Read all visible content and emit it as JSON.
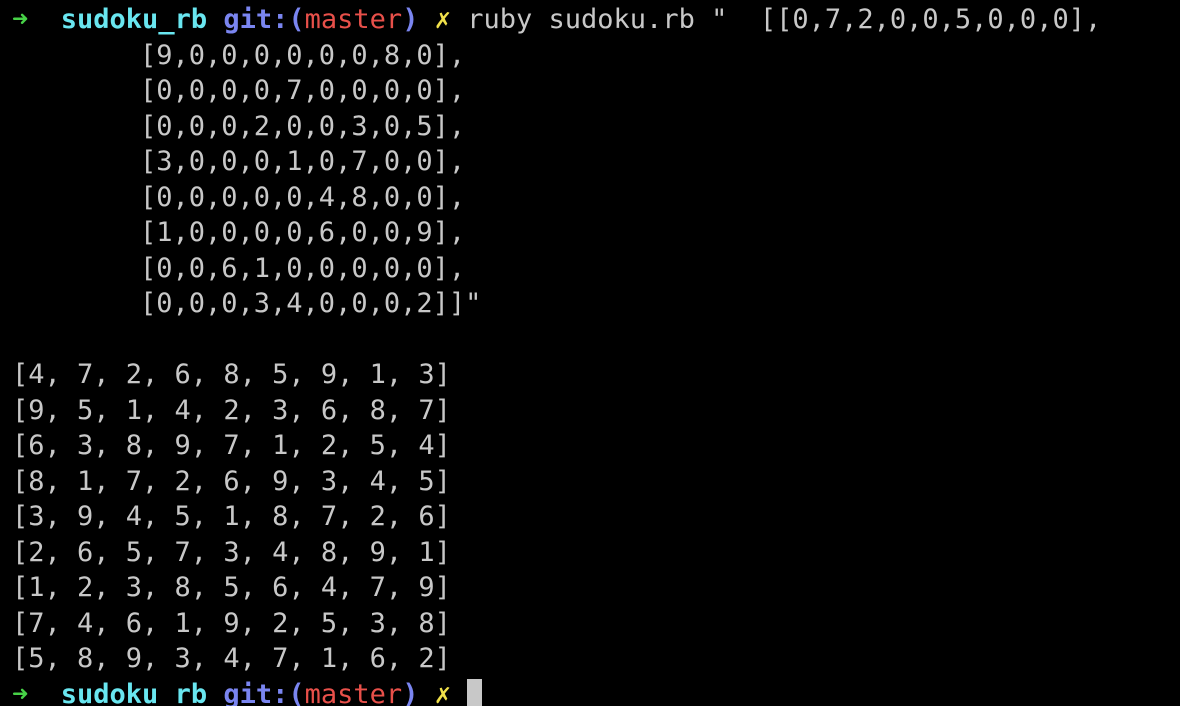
{
  "prompt": {
    "arrow": "➜",
    "directory": "sudoku_rb",
    "git_prefix": "git:(",
    "branch": "master",
    "git_suffix": ")",
    "dirty_mark": "✗"
  },
  "command": {
    "text": "ruby sudoku.rb \"  [[0,7,2,0,0,5,0,0,0],",
    "continuation_lines": [
      "[9,0,0,0,0,0,0,8,0],",
      "[0,0,0,0,7,0,0,0,0],",
      "[0,0,0,2,0,0,3,0,5],",
      "[3,0,0,0,1,0,7,0,0],",
      "[0,0,0,0,0,4,8,0,0],",
      "[1,0,0,0,0,6,0,0,9],",
      "[0,0,6,1,0,0,0,0,0],",
      "[0,0,0,3,4,0,0,0,2]]\""
    ]
  },
  "output": {
    "rows": [
      "[4, 7, 2, 6, 8, 5, 9, 1, 3]",
      "[9, 5, 1, 4, 2, 3, 6, 8, 7]",
      "[6, 3, 8, 9, 7, 1, 2, 5, 4]",
      "[8, 1, 7, 2, 6, 9, 3, 4, 5]",
      "[3, 9, 4, 5, 1, 8, 7, 2, 6]",
      "[2, 6, 5, 7, 3, 4, 8, 9, 1]",
      "[1, 2, 3, 8, 5, 6, 4, 7, 9]",
      "[7, 4, 6, 1, 9, 2, 5, 3, 8]",
      "[5, 8, 9, 3, 4, 7, 1, 6, 2]"
    ]
  },
  "colors": {
    "background": "#000000",
    "text": "#c8c8c8",
    "arrow": "#47d147",
    "directory": "#69e6f0",
    "git": "#7a85f0",
    "branch": "#e8504a",
    "dirty": "#f0e04a"
  }
}
